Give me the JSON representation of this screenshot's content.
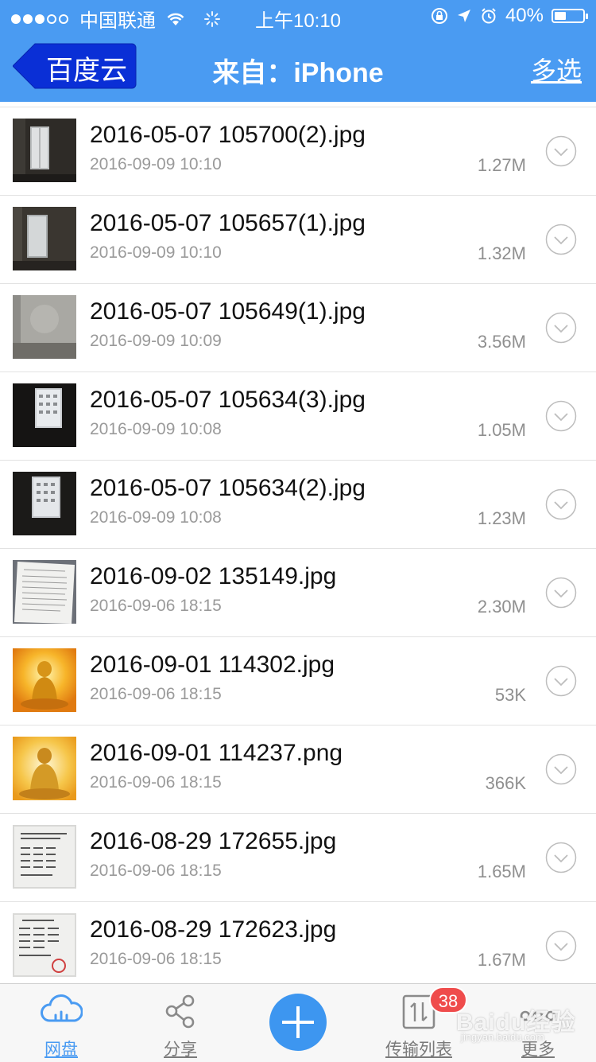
{
  "status_bar": {
    "carrier": "中国联通",
    "time": "上午10:10",
    "battery": "40%",
    "battery_level": 0.4
  },
  "nav": {
    "back_label": "百度云",
    "title": "来自：iPhone",
    "multi_select": "多选"
  },
  "files": [
    {
      "name": "2016-05-07 105700(2).jpg",
      "date": "2016-09-09 10:10",
      "size": "1.27M"
    },
    {
      "name": "2016-05-07 105657(1).jpg",
      "date": "2016-09-09 10:10",
      "size": "1.32M"
    },
    {
      "name": "2016-05-07 105649(1).jpg",
      "date": "2016-09-09 10:09",
      "size": "3.56M"
    },
    {
      "name": "2016-05-07 105634(3).jpg",
      "date": "2016-09-09 10:08",
      "size": "1.05M"
    },
    {
      "name": "2016-05-07 105634(2).jpg",
      "date": "2016-09-09 10:08",
      "size": "1.23M"
    },
    {
      "name": "2016-09-02 135149.jpg",
      "date": "2016-09-06 18:15",
      "size": "2.30M"
    },
    {
      "name": "2016-09-01 114302.jpg",
      "date": "2016-09-06 18:15",
      "size": "53K"
    },
    {
      "name": "2016-09-01 114237.png",
      "date": "2016-09-06 18:15",
      "size": "366K"
    },
    {
      "name": "2016-08-29 172655.jpg",
      "date": "2016-09-06 18:15",
      "size": "1.65M"
    },
    {
      "name": "2016-08-29 172623.jpg",
      "date": "2016-09-06 18:15",
      "size": "1.67M"
    }
  ],
  "tabs": {
    "netdisk": "网盘",
    "share": "分享",
    "transfer": "传输列表",
    "more": "更多",
    "transfer_badge": "38"
  },
  "watermark": {
    "brand": "Baidu经验",
    "url": "jingyan.baidu.com"
  },
  "colors": {
    "header": "#4a9bf2",
    "back_button": "#0a2fd6",
    "active_tab": "#4a9bf2",
    "badge": "#ef4c4c"
  }
}
